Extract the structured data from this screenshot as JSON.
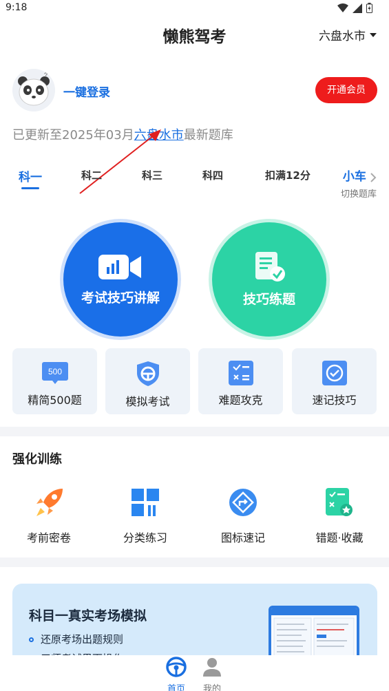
{
  "status": {
    "time": "9:18"
  },
  "header": {
    "title": "懒熊驾考",
    "city": "六盘水市"
  },
  "user": {
    "login_label": "一键登录",
    "vip_label": "开通会员"
  },
  "update": {
    "prefix": "已更新至2025年03月",
    "city": "六盘水市",
    "suffix": "最新题库"
  },
  "tabs": [
    {
      "label": "科一"
    },
    {
      "label": "科二"
    },
    {
      "label": "科三"
    },
    {
      "label": "科四"
    },
    {
      "label": "扣满12分"
    }
  ],
  "car": {
    "label": "小车",
    "sub": "切换题库"
  },
  "main_buttons": [
    {
      "label": "考试技巧讲解"
    },
    {
      "label": "技巧练题"
    }
  ],
  "grid": [
    {
      "label": "精简500题",
      "badge": "500"
    },
    {
      "label": "模拟考试"
    },
    {
      "label": "难题攻克"
    },
    {
      "label": "速记技巧"
    }
  ],
  "training": {
    "title": "强化训练",
    "items": [
      {
        "label": "考前密卷"
      },
      {
        "label": "分类练习"
      },
      {
        "label": "图标速记"
      },
      {
        "label": "错题·收藏"
      }
    ]
  },
  "banner": {
    "title": "科目一真实考场模拟",
    "bullets": [
      "还原考场出题规则",
      "三师考试界面操作"
    ]
  },
  "bottom_nav": [
    {
      "label": "首页"
    },
    {
      "label": "我的"
    }
  ],
  "colors": {
    "accent": "#1a6fe0",
    "vip": "#ee1c1c",
    "green": "#2cd3a5"
  }
}
